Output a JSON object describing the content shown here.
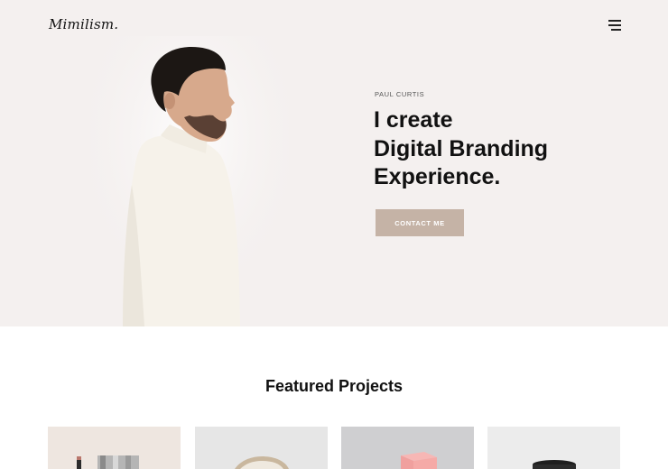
{
  "header": {
    "logo_text": "Mimilism.",
    "menu_icon": "hamburger-menu-icon"
  },
  "hero": {
    "eyebrow": "PAUL CURTIS",
    "headline_lines": [
      "I create",
      "Digital Branding",
      "Experience."
    ],
    "cta_label": "CONTACT ME",
    "background_color": "#f4f0ef",
    "cta_color": "#c5b3a6"
  },
  "projects": {
    "title": "Featured Projects",
    "cards": [
      {
        "image": "cosmetics-product-photo"
      },
      {
        "image": "wooden-bowl-product-photo"
      },
      {
        "image": "pink-box-product-photo"
      },
      {
        "image": "dark-jar-product-photo"
      }
    ]
  }
}
